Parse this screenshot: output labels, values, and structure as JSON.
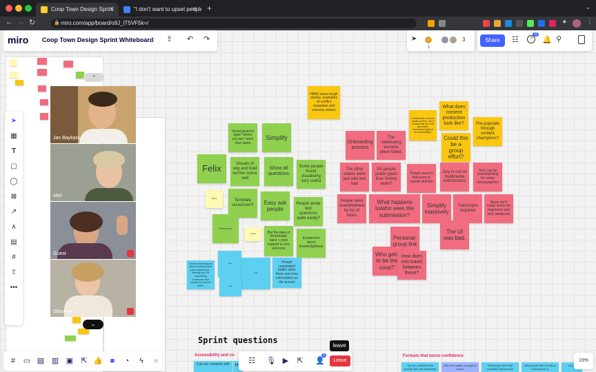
{
  "browser": {
    "tabs": [
      {
        "title": "Coop Town Design Sprint",
        "active": true
      },
      {
        "title": "\"I don't want to upset people\"",
        "active": false
      }
    ],
    "new_tab": "+",
    "url": "miro.com/app/board/o9J_lT5VF5k=/"
  },
  "miro": {
    "logo": "miro",
    "board_title": "Coop Town Design Sprint Whiteboard",
    "share_label": "Share",
    "collaborator_count": "3",
    "notification_count": "11",
    "avatar_badge": "1",
    "zoom": "19%",
    "leave_tooltip": "leave",
    "leave_label": "Leave",
    "user_count_badge": "1"
  },
  "participants": [
    {
      "name": "Jan Baykara"
    },
    {
      "name": "shiri"
    },
    {
      "name": "Guest"
    },
    {
      "name": "Shaunna"
    }
  ],
  "stickies": [
    {
      "text": "HMW share tough stories, examples of conflict resolution and success stories"
    },
    {
      "text": "Vision/goals/st ages \"where you are\" more than tasks"
    },
    {
      "text": "Simplify"
    },
    {
      "text": "Felix"
    },
    {
      "text": "Visuals of veg and food set the scene well"
    },
    {
      "text": "Show all questions"
    },
    {
      "text": "Some people found visualising very useful"
    },
    {
      "text": "Template resources!!!"
    },
    {
      "text": "Easy ask people"
    },
    {
      "text": "People wrote text questions quite easily?"
    },
    {
      "text": "But the idea of knowledge base + peer support is very welcome"
    },
    {
      "text": "Excitement about knowledgebase"
    },
    {
      "text": "Some reservations about sharing their own experience - feeling like it's something someone else would do but not them"
    },
    {
      "text": "People responded better when there was less information on the screen"
    },
    {
      "text": "Onboarding process"
    },
    {
      "text": "The celebrating success piece failed."
    },
    {
      "text": "If audio/video used to create content, can it include that tool that generates transcripts/captions for accessibility?"
    },
    {
      "text": "What does content production look like?"
    },
    {
      "text": "Pre populate through content champions?"
    },
    {
      "text": "Could this be a group effort?"
    },
    {
      "text": "The other videos were just wild and bad"
    },
    {
      "text": "Do people prefer goals than history tasks?"
    },
    {
      "text": "People weren't that keen to submit stuff tbh"
    },
    {
      "text": "Jury is out on multimedia submissions"
    },
    {
      "text": "Tech can be overwhelming for some demographics"
    },
    {
      "text": "People were overwhelmed by list of tasks"
    },
    {
      "text": "What happens to/who sees the submission?"
    },
    {
      "text": "Simplify massively"
    },
    {
      "text": "Transcripts required"
    },
    {
      "text": "Steps don't make sense for beginners and very advanced"
    },
    {
      "text": "The UI was bad."
    },
    {
      "text": "Personal-group link"
    },
    {
      "text": "Who gets to be the coop?"
    },
    {
      "text": "How does info travel between these?"
    }
  ],
  "sections": {
    "sprint_questions": "Sprint questions",
    "accessibility": "Accessibility and co",
    "formats": "Formats that boost confidence",
    "bottom_cards": [
      "Can we compete with",
      "Ho",
      "Are we confident that people who are interested",
      "Will it be usable enough to boost",
      "Will people feel truly confident without any",
      "Will people learn to follow instructions or",
      "Can w"
    ]
  }
}
